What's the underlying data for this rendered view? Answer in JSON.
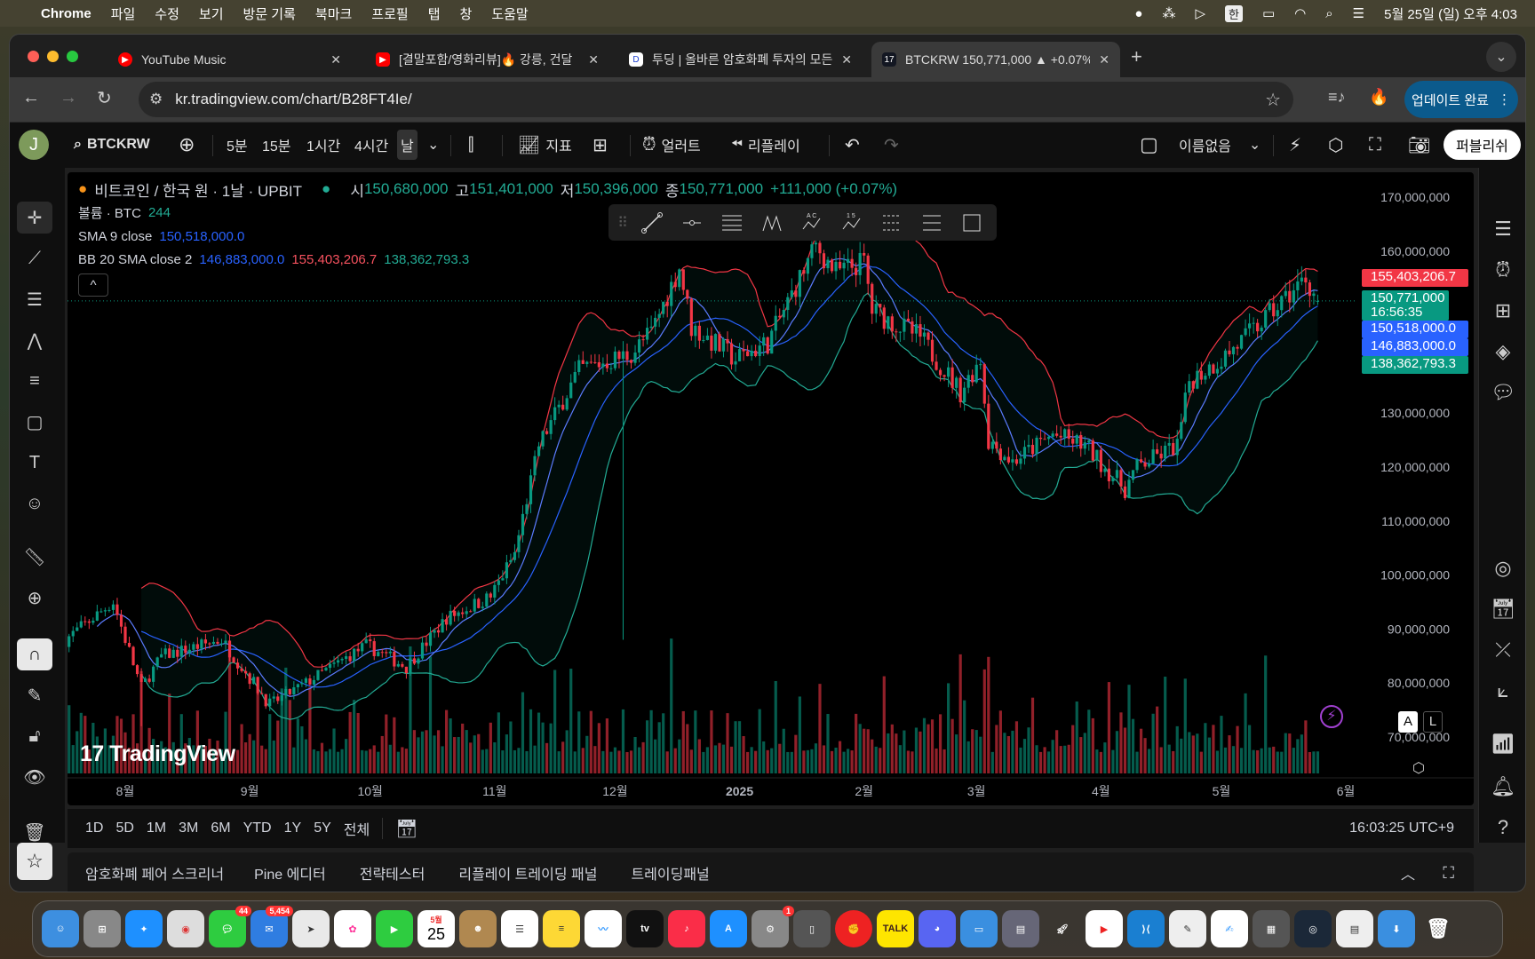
{
  "menubar": {
    "app": "Chrome",
    "items": [
      "파일",
      "수정",
      "보기",
      "방문 기록",
      "북마크",
      "프로필",
      "탭",
      "창",
      "도움말"
    ],
    "ime": "한",
    "datetime": "5월 25일 (일) 오후 4:03"
  },
  "browser": {
    "tabs": [
      {
        "title": "YouTube Music"
      },
      {
        "title": "[결말포함/영화리뷰]🔥 강릉, 건달"
      },
      {
        "title": "투딩 | 올바른 암호화폐 투자의 모든"
      },
      {
        "title": "BTCKRW 150,771,000 ▲ +0.07%",
        "active": true
      }
    ],
    "url": "kr.tradingview.com/chart/B28FT4Ie/",
    "update_label": "업데이트 완료"
  },
  "toolbar": {
    "avatar": "J",
    "symbol": "BTCKRW",
    "intervals": [
      "5분",
      "15분",
      "1시간",
      "4시간",
      "날"
    ],
    "indicators": "지표",
    "alert": "얼러트",
    "replay": "리플레이",
    "layout_name": "이름없음",
    "publish": "퍼블리쉬"
  },
  "legend": {
    "title": "비트코인 / 한국 원 · 1날 · UPBIT",
    "o_label": "시",
    "o": "150,680,000",
    "h_label": "고",
    "h": "151,401,000",
    "l_label": "저",
    "l": "150,396,000",
    "c_label": "종",
    "c": "150,771,000",
    "change": "+111,000 (+0.07%)",
    "volume_label": "볼륨 · BTC",
    "volume": "244",
    "sma_label": "SMA 9 close",
    "sma": "150,518,000.0",
    "bb_label": "BB 20 SMA close 2",
    "bb_basis": "146,883,000.0",
    "bb_upper": "155,403,206.7",
    "bb_lower": "138,362,793.3"
  },
  "price_labels": {
    "upper": "155,403,206.7",
    "last": "150,771,000",
    "countdown": "16:56:35",
    "sma": "150,518,000.0",
    "basis": "146,883,000.0",
    "lower": "138,362,793.3"
  },
  "axis_buttons": {
    "auto": "A",
    "log": "L"
  },
  "watermark": "TradingView",
  "range": {
    "buttons": [
      "1D",
      "5D",
      "1M",
      "3M",
      "6M",
      "YTD",
      "1Y",
      "5Y",
      "전체"
    ],
    "clock": "16:03:25 UTC+9"
  },
  "bottom_tabs": [
    "암호화폐 페어 스크리너",
    "Pine 에디터",
    "전략테스터",
    "리플레이 트레이딩 패널",
    "트레이딩패널"
  ],
  "dock": {
    "calendar_month": "5월",
    "calendar_day": "25",
    "badges": {
      "messages": "44",
      "mail": "5,454",
      "settings": "1"
    }
  },
  "colors": {
    "up": "#089981",
    "down": "#f23645",
    "sma": "#2962ff",
    "bb_upper": "#f23645",
    "bb_lower": "#22ab94",
    "accent": "#2962ff"
  },
  "chart_data": {
    "type": "candlestick",
    "symbol": "BTCKRW",
    "interval": "1D",
    "exchange": "UPBIT",
    "yticks": [
      170000000,
      160000000,
      130000000,
      120000000,
      110000000,
      100000000,
      90000000,
      80000000,
      70000000
    ],
    "ytick_labels": [
      "170,000,000",
      "160,000,000",
      "130,000,000",
      "120,000,000",
      "110,000,000",
      "100,000,000",
      "90,000,000",
      "80,000,000",
      "70,000,000"
    ],
    "ylim": [
      70000000,
      170000000
    ],
    "xticks": [
      {
        "date": "2024-08-01",
        "label": "8월"
      },
      {
        "date": "2024-09-01",
        "label": "9월"
      },
      {
        "date": "2024-10-01",
        "label": "10월"
      },
      {
        "date": "2024-11-01",
        "label": "11월"
      },
      {
        "date": "2024-12-01",
        "label": "12월"
      },
      {
        "date": "2025-01-01",
        "label": "2025"
      },
      {
        "date": "2025-02-01",
        "label": "2월"
      },
      {
        "date": "2025-03-01",
        "label": "3월"
      },
      {
        "date": "2025-04-01",
        "label": "4월"
      },
      {
        "date": "2025-05-01",
        "label": "5월"
      },
      {
        "date": "2025-06-01",
        "label": "6월"
      }
    ],
    "close_anchors_millions": [
      [
        "2024-07-17",
        88
      ],
      [
        "2024-07-29",
        95
      ],
      [
        "2024-08-05",
        79
      ],
      [
        "2024-08-10",
        85
      ],
      [
        "2024-08-25",
        88
      ],
      [
        "2024-09-06",
        76
      ],
      [
        "2024-09-15",
        80
      ],
      [
        "2024-09-30",
        87
      ],
      [
        "2024-10-10",
        83
      ],
      [
        "2024-10-20",
        92
      ],
      [
        "2024-10-31",
        96
      ],
      [
        "2024-11-06",
        104
      ],
      [
        "2024-11-12",
        124
      ],
      [
        "2024-11-22",
        138
      ],
      [
        "2024-12-05",
        141
      ],
      [
        "2024-12-10",
        145
      ],
      [
        "2024-12-17",
        157
      ],
      [
        "2024-12-20",
        146
      ],
      [
        "2024-12-31",
        140
      ],
      [
        "2025-01-08",
        143
      ],
      [
        "2025-01-20",
        161
      ],
      [
        "2025-01-25",
        156
      ],
      [
        "2025-02-01",
        158
      ],
      [
        "2025-02-03",
        149
      ],
      [
        "2025-02-15",
        144
      ],
      [
        "2025-02-25",
        134
      ],
      [
        "2025-03-02",
        140
      ],
      [
        "2025-03-04",
        125
      ],
      [
        "2025-03-10",
        121
      ],
      [
        "2025-03-20",
        126
      ],
      [
        "2025-03-28",
        124
      ],
      [
        "2025-04-07",
        116
      ],
      [
        "2025-04-10",
        120
      ],
      [
        "2025-04-20",
        124
      ],
      [
        "2025-04-23",
        136
      ],
      [
        "2025-05-01",
        140
      ],
      [
        "2025-05-10",
        146
      ],
      [
        "2025-05-22",
        155
      ],
      [
        "2025-05-25",
        150.771
      ]
    ],
    "notable_wicks_millions": [
      [
        "2024-08-05",
        72
      ],
      [
        "2024-12-03",
        88
      ]
    ],
    "last": {
      "open": 150680000,
      "high": 151401000,
      "low": 150396000,
      "close": 150771000
    }
  }
}
